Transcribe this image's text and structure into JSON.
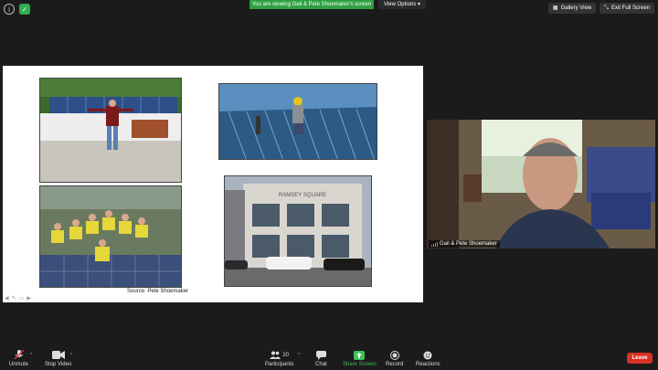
{
  "top": {
    "viewing_banner": "You are viewing Gail & Pete Shoemaker's screen",
    "view_options": "View Options",
    "gallery_view": "Gallery View",
    "exit_full_screen": "Exit Full Screen"
  },
  "slide": {
    "source": "Source: Pete Shoemaker",
    "building_sign": "RAMSEY SQUARE"
  },
  "video": {
    "participant_name": "Gail & Pete Shoemaker"
  },
  "toolbar": {
    "unmute": "Unmute",
    "stop_video": "Stop Video",
    "participants": "Participants",
    "participants_count": "20",
    "chat": "Chat",
    "share_screen": "Share Screen",
    "record": "Record",
    "reactions": "Reactions",
    "leave": "Leave"
  },
  "colors": {
    "share_green": "#2ea043",
    "leave_red": "#d93025"
  }
}
